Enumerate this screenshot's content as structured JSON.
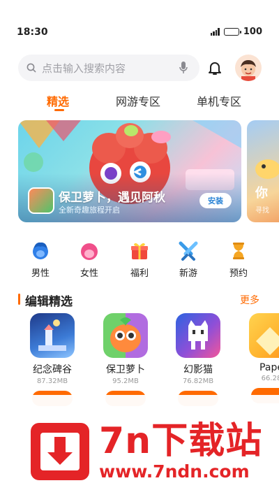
{
  "status": {
    "time": "18:30",
    "battery": "100"
  },
  "search": {
    "placeholder": "点击输入搜索内容"
  },
  "tabs": [
    {
      "label": "精选",
      "active": true
    },
    {
      "label": "网游专区",
      "active": false
    },
    {
      "label": "单机专区",
      "active": false
    }
  ],
  "banner": {
    "title": "保卫萝卜，遇见阿秋",
    "subtitle": "全新奇趣旅程开启",
    "install": "安装",
    "next_title": "你",
    "next_subtitle": "寻找"
  },
  "categories": [
    {
      "label": "男性",
      "icon": "male-avatar-icon",
      "color": "#2f7fe8"
    },
    {
      "label": "女性",
      "icon": "female-avatar-icon",
      "color": "#f04f8a"
    },
    {
      "label": "福利",
      "icon": "gift-icon",
      "color": "#f0483c"
    },
    {
      "label": "新游",
      "icon": "crossed-swords-icon",
      "color": "#3a9be8"
    },
    {
      "label": "预约",
      "icon": "hourglass-icon",
      "color": "#f5a623"
    }
  ],
  "section": {
    "title": "编辑精选",
    "more": "更多"
  },
  "apps": [
    {
      "name": "纪念碑谷",
      "size": "87.32MB",
      "icon": "monument-valley-icon"
    },
    {
      "name": "保卫萝卜",
      "size": "95.2MB",
      "icon": "carrot-defense-icon"
    },
    {
      "name": "幻影猫",
      "size": "76.82MB",
      "icon": "phantom-cat-icon"
    },
    {
      "name": "Pape",
      "size": "66.28",
      "icon": "paper-game-icon"
    }
  ],
  "watermark": {
    "brand": "7n下载站",
    "url": "www.7ndn.com"
  },
  "colors": {
    "accent": "#ff6a00",
    "watermark": "#e42427"
  }
}
